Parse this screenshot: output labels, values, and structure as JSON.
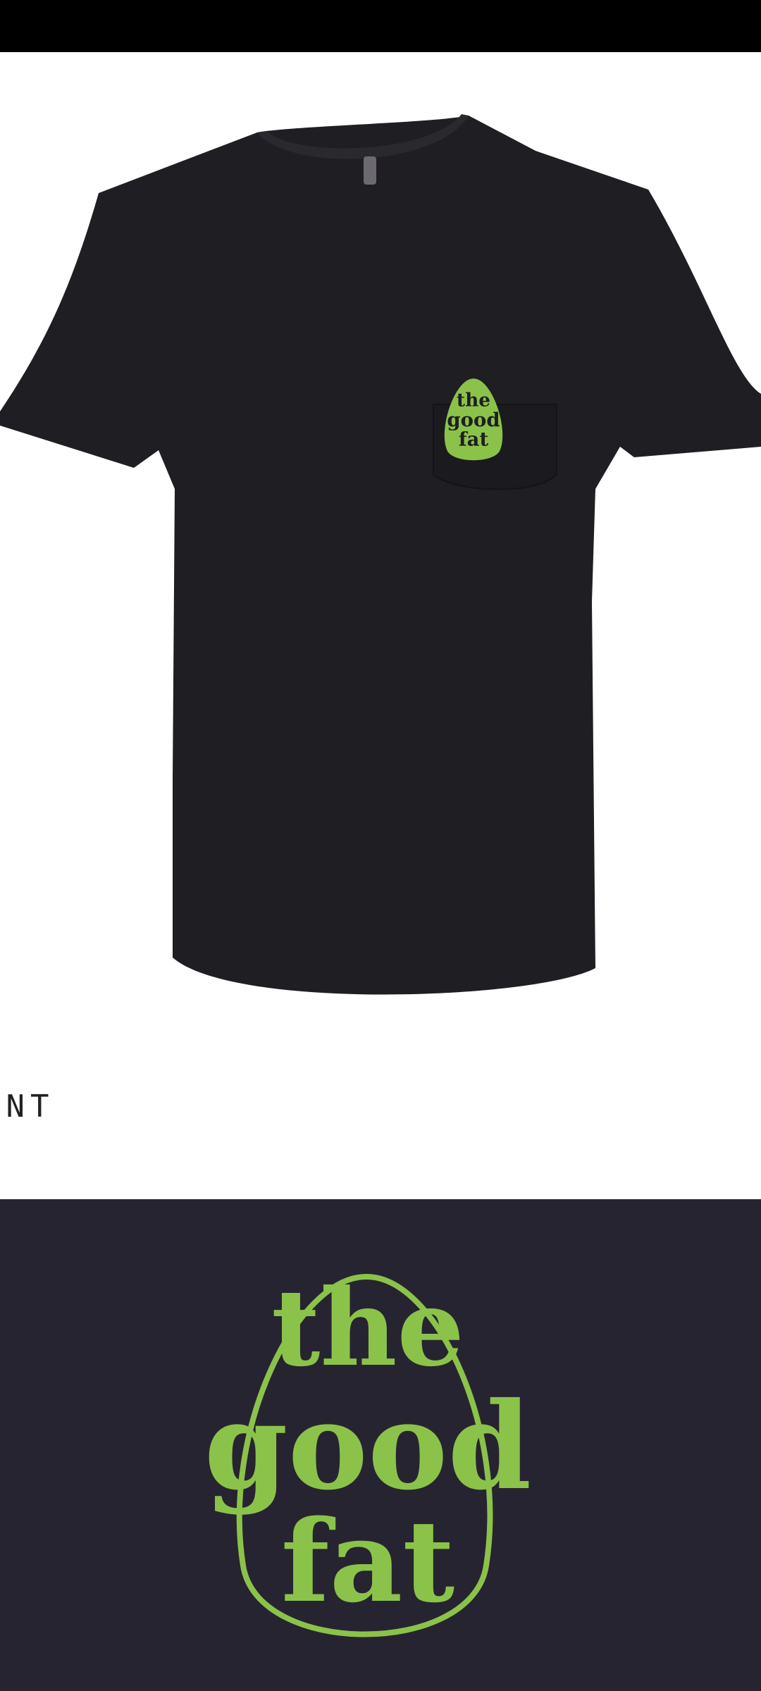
{
  "product": {
    "name": "the good fat",
    "view_label": "ONT",
    "design_lines": [
      "the",
      "good",
      "fat"
    ]
  },
  "colors": {
    "shirt": "#1f1e22",
    "logo_green": "#8bc34a",
    "panel_bg": "#272431",
    "top_bar": "#000000"
  },
  "icons": {
    "neck_label": "tag-icon",
    "pocket_logo": "avocado-logo-icon",
    "design_logo": "avocado-logo-icon"
  }
}
